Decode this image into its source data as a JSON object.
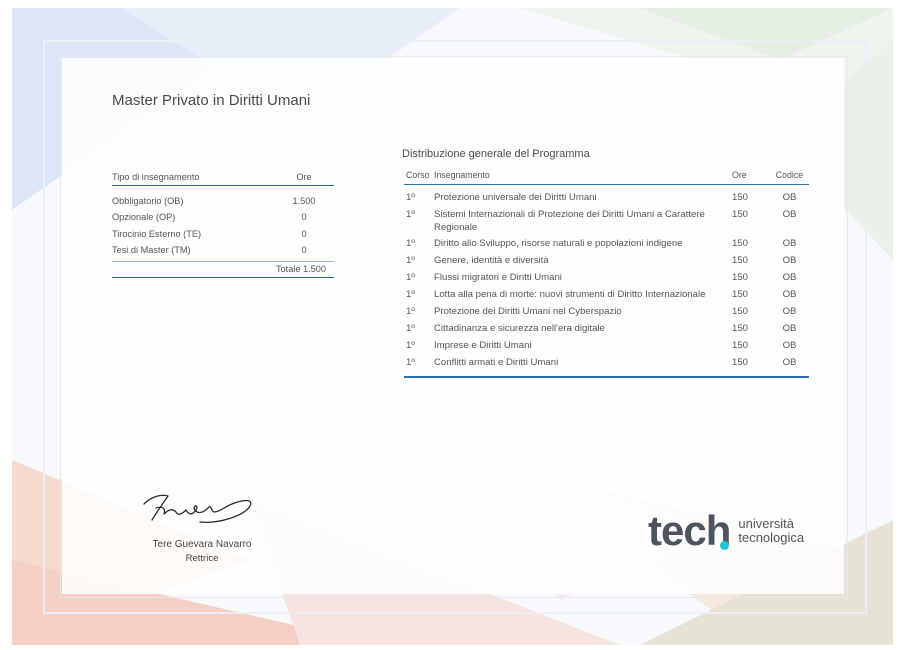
{
  "document": {
    "title": "Master Privato in Diritti Umani"
  },
  "type_table": {
    "headers": [
      "Tipo di insegnamento",
      "Ore"
    ],
    "rows": [
      {
        "type": "Obbligatorio (OB)",
        "hours": "1.500"
      },
      {
        "type": "Opzionale (OP)",
        "hours": "0"
      },
      {
        "type": "Tirocinio Esterno (TE)",
        "hours": "0"
      },
      {
        "type": "Tesi di Master (TM)",
        "hours": "0"
      }
    ],
    "total": "Totale 1.500"
  },
  "program": {
    "title": "Distribuzione generale del Programma",
    "headers": [
      "Corso",
      "Insegnamento",
      "Ore",
      "Codice"
    ],
    "rows": [
      {
        "course": "1º",
        "subject": "Protezione universale dei Diritti Umani",
        "hours": "150",
        "code": "OB"
      },
      {
        "course": "1º",
        "subject": "Sistemi Internazionali di Protezione dei Diritti Umani a Carattere Regionale",
        "hours": "150",
        "code": "OB"
      },
      {
        "course": "1º",
        "subject": "Diritto allo Sviluppo, risorse naturali e popolazioni indigene",
        "hours": "150",
        "code": "OB"
      },
      {
        "course": "1º",
        "subject": "Genere, identità e diversità",
        "hours": "150",
        "code": "OB"
      },
      {
        "course": "1º",
        "subject": "Flussi migratori e Diritti Umani",
        "hours": "150",
        "code": "OB"
      },
      {
        "course": "1º",
        "subject": "Lotta alla pena di morte: nuovi strumenti di Diritto Internazionale",
        "hours": "150",
        "code": "OB"
      },
      {
        "course": "1º",
        "subject": "Protezione dei Diritti Umani nel Cyberspazio",
        "hours": "150",
        "code": "OB"
      },
      {
        "course": "1º",
        "subject": "Cittadinanza e sicurezza nell'era digitale",
        "hours": "150",
        "code": "OB"
      },
      {
        "course": "1º",
        "subject": "Imprese e Diritti Umani",
        "hours": "150",
        "code": "OB"
      },
      {
        "course": "1º",
        "subject": "Conflitti armati e Diritti Umani",
        "hours": "150",
        "code": "OB"
      }
    ]
  },
  "signatory": {
    "name": "Tere Guevara Navarro",
    "role": "Rettrice"
  },
  "logo": {
    "word_main": "tec",
    "word_h": "h",
    "line1": "università",
    "line2": "tecnologica",
    "dot_color": "#1fc7d8"
  },
  "colors": {
    "accent": "#2b6fb3"
  }
}
